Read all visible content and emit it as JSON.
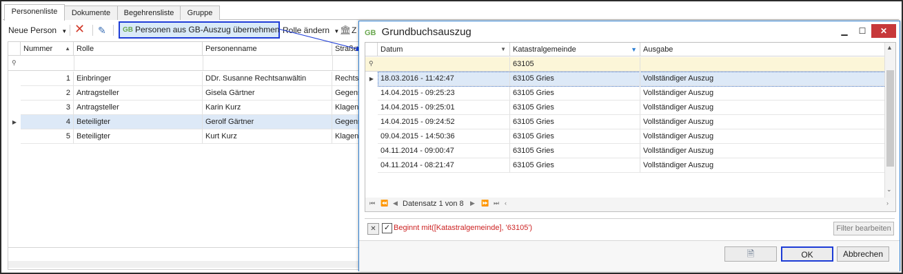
{
  "tabs": [
    "Personenliste",
    "Dokumente",
    "Begehrensliste",
    "Gruppe"
  ],
  "toolbar": {
    "new_person": "Neue Person",
    "gb_button_glyph": "GB",
    "gb_button": "Personen aus GB-Auszug übernehmen",
    "change_role": "Rolle ändern",
    "cut_text": "Z"
  },
  "left_grid": {
    "columns": [
      "Nummer",
      "Rolle",
      "Personenname",
      "Straße"
    ],
    "rows": [
      {
        "num": "1",
        "role": "Einbringer",
        "name": "DDr. Susanne Rechtsanwältin",
        "street": "Rechtsw"
      },
      {
        "num": "2",
        "role": "Antragsteller",
        "name": "Gisela Gärtner",
        "street": "Gegensc"
      },
      {
        "num": "3",
        "role": "Antragsteller",
        "name": "Karin Kurz",
        "street": "Klagenf"
      },
      {
        "num": "4",
        "role": "Beteiligter",
        "name": "Gerolf Gärtner",
        "street": "Gegensc"
      },
      {
        "num": "5",
        "role": "Beteiligter",
        "name": "Kurt Kurz",
        "street": "Klagenf"
      }
    ]
  },
  "dialog": {
    "title_glyph": "GB",
    "title": "Grundbuchsauszug",
    "columns": [
      "Datum",
      "Katastralgemeinde",
      "Ausgabe"
    ],
    "filter_value": "63105",
    "rows": [
      {
        "date": "18.03.2016 - 11:42:47",
        "kg": "63105 Gries",
        "out": "Vollständiger Auszug"
      },
      {
        "date": "14.04.2015 - 09:25:23",
        "kg": "63105 Gries",
        "out": "Vollständiger Auszug"
      },
      {
        "date": "14.04.2015 - 09:25:01",
        "kg": "63105 Gries",
        "out": "Vollständiger Auszug"
      },
      {
        "date": "14.04.2015 - 09:24:52",
        "kg": "63105 Gries",
        "out": "Vollständiger Auszug"
      },
      {
        "date": "09.04.2015 - 14:50:36",
        "kg": "63105 Gries",
        "out": "Vollständiger Auszug"
      },
      {
        "date": "04.11.2014 - 09:00:47",
        "kg": "63105 Gries",
        "out": "Vollständiger Auszug"
      },
      {
        "date": "04.11.2014 - 08:21:47",
        "kg": "63105 Gries",
        "out": "Vollständiger Auszug"
      }
    ],
    "navigator": "Datensatz 1 von 8",
    "filter_text": "Beginnt mit([Katastralgemeinde], '63105')",
    "edit_filter": "Filter bearbeiten",
    "ok": "OK",
    "cancel": "Abbrechen"
  },
  "colors": {
    "selection_border": "#1c3bd6",
    "accent": "#2d7fd3",
    "filter_text": "#cc2222",
    "close": "#c7383a"
  }
}
